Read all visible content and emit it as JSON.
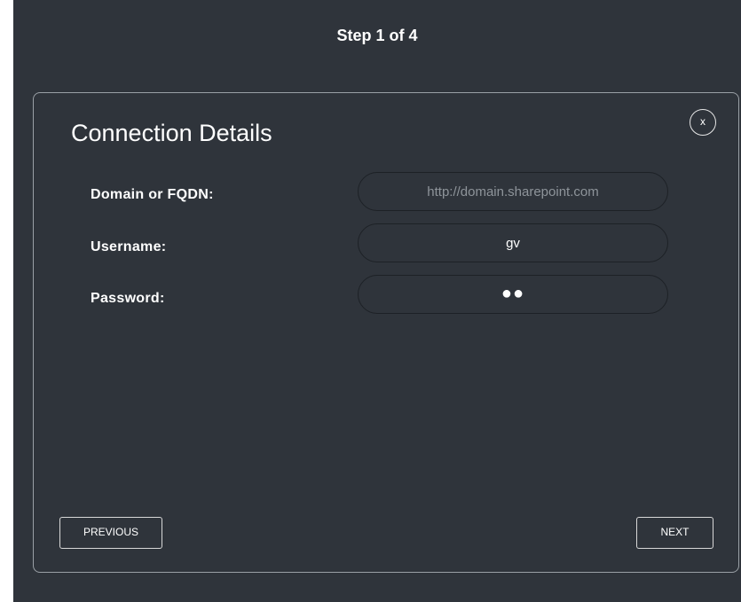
{
  "wizard": {
    "step_text": "Step 1 of  4"
  },
  "dialog": {
    "title": "Connection Details",
    "close_label": "x",
    "fields": {
      "domain": {
        "label": "Domain or FQDN:",
        "value": "",
        "placeholder": "http://domain.sharepoint.com"
      },
      "username": {
        "label": "Username:",
        "value": "gv"
      },
      "password": {
        "label": "Password:",
        "masked_value": "●●"
      }
    },
    "buttons": {
      "previous": "PREVIOUS",
      "next": "NEXT"
    }
  }
}
